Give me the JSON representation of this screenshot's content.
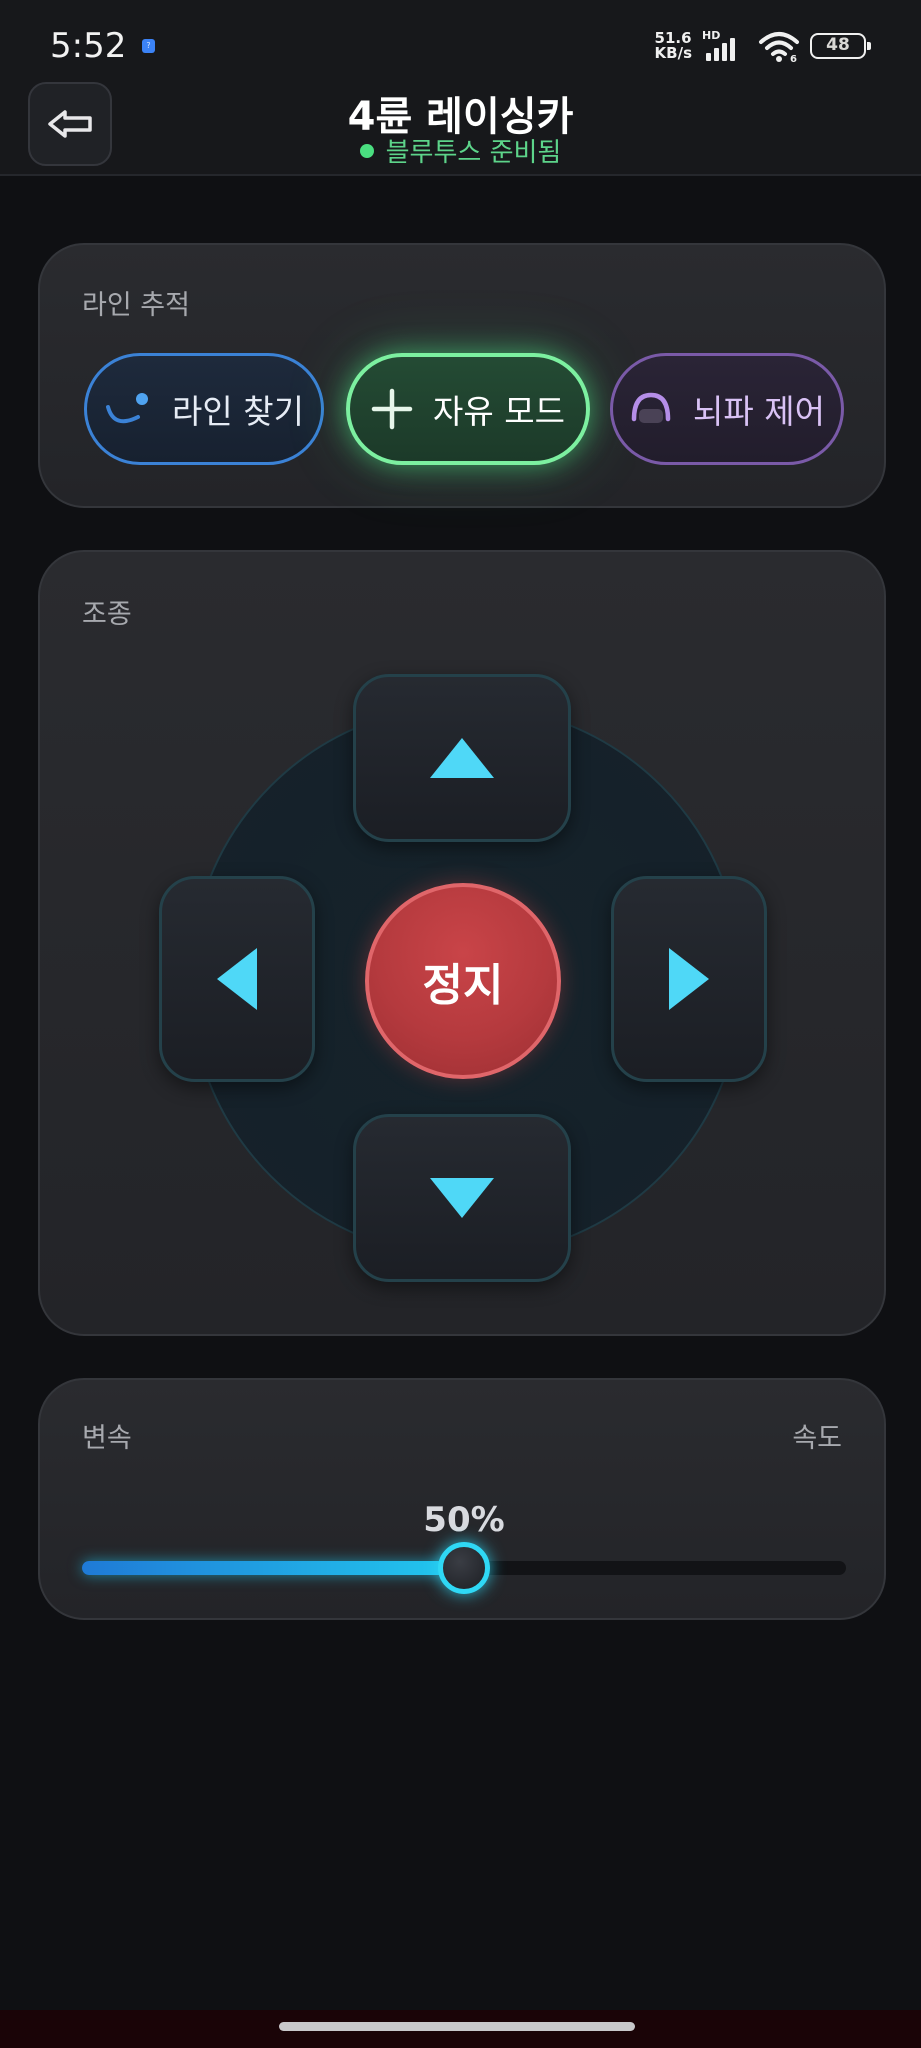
{
  "status_bar": {
    "time": "5:52",
    "notif_icon": "app-notification-icon",
    "net_speed_value": "51.6",
    "net_speed_unit": "KB/s",
    "network_type": "HD",
    "wifi_badge": "6",
    "battery_level": "48"
  },
  "header": {
    "back_icon": "arrow-left-icon",
    "title": "4륜 레이싱카",
    "connection_status": "블루투스 준비됨"
  },
  "line_tracking": {
    "label": "라인 추적",
    "modes": [
      {
        "label": "라인 찾기",
        "icon": "line-follow-icon",
        "active": false
      },
      {
        "label": "자유 모드",
        "icon": "plus-icon",
        "active": true
      },
      {
        "label": "뇌파 제어",
        "icon": "brainwave-icon",
        "active": false
      }
    ]
  },
  "control": {
    "label": "조종",
    "stop_label": "정지",
    "icons": [
      "arrow-up-icon",
      "arrow-down-icon",
      "arrow-left-icon",
      "arrow-right-icon"
    ]
  },
  "speed": {
    "left_label": "변속",
    "right_label": "속도",
    "value_text": "50%",
    "value_percent": 50
  },
  "colors": {
    "accent_cyan": "#4fd8f7",
    "active_green": "#7cf0a0",
    "line_blue": "#3b82d6",
    "brain_purple": "#7a5aa8",
    "stop_red": "#b53a3e"
  }
}
